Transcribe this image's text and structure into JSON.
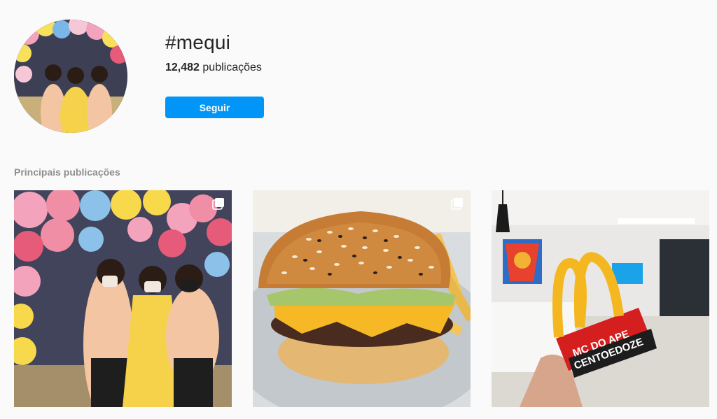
{
  "hashtag": {
    "title": "#mequi",
    "post_count": "12,482",
    "post_count_label": "publicações",
    "follow_label": "Seguir"
  },
  "top_posts": {
    "section_title": "Principais publicações",
    "posts": [
      {
        "kind": "photo",
        "multi": true
      },
      {
        "kind": "photo",
        "multi": true
      },
      {
        "kind": "photo",
        "multi": false,
        "sign_text_line1": "MC DO APE",
        "sign_text_line2": "CENTOEDOZE"
      }
    ]
  },
  "colors": {
    "accent": "#0095f6",
    "background": "#fafafa",
    "muted_text": "#8e8e8e"
  }
}
